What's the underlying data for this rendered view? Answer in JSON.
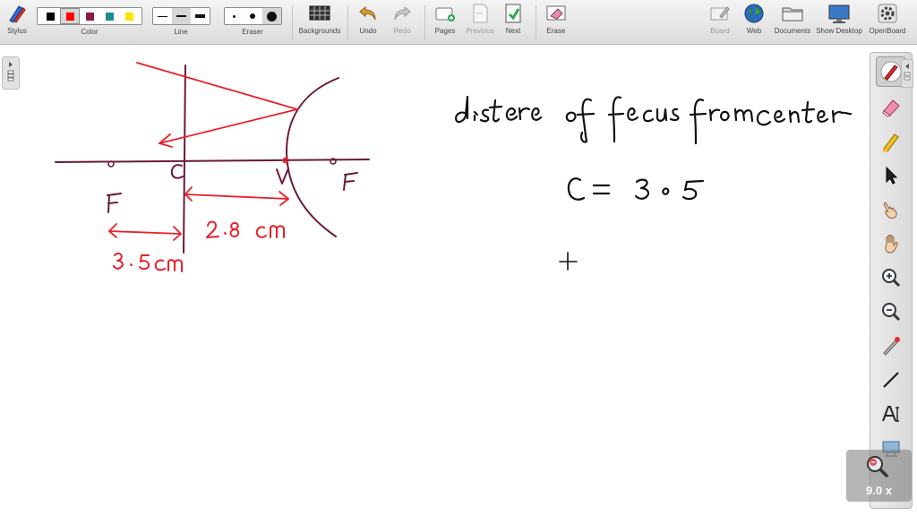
{
  "toolbar": {
    "stylus": "Stylus",
    "color": "Color",
    "line": "Line",
    "eraser": "Eraser",
    "backgrounds": "Backgrounds",
    "undo": "Undo",
    "redo": "Redo",
    "pages": "Pages",
    "previous": "Previous",
    "next": "Next",
    "erase": "Erase",
    "board": "Board",
    "web": "Web",
    "documents": "Documents",
    "show_desktop": "Show Desktop",
    "openboard": "OpenBoard"
  },
  "colors": {
    "swatches": [
      "#000000",
      "#ff0000",
      "#8b1a4a",
      "#1a8f8f",
      "#ffe400"
    ],
    "selected": "#ff0000",
    "ink_red": "#e8202a",
    "ink_maroon": "#6a1a3a",
    "ink_black": "#111111"
  },
  "zoom": {
    "label": "9.0 x"
  },
  "icons": {
    "stylus": "stylus-icon",
    "backgrounds": "grid-icon",
    "undo": "undo-icon",
    "redo": "redo-icon",
    "pages": "add-page-icon",
    "previous": "previous-page-icon",
    "next": "next-page-icon",
    "erase": "erase-board-icon",
    "board": "board-icon",
    "web": "globe-icon",
    "documents": "folder-icon",
    "show_desktop": "monitor-icon",
    "openboard": "gear-icon"
  }
}
